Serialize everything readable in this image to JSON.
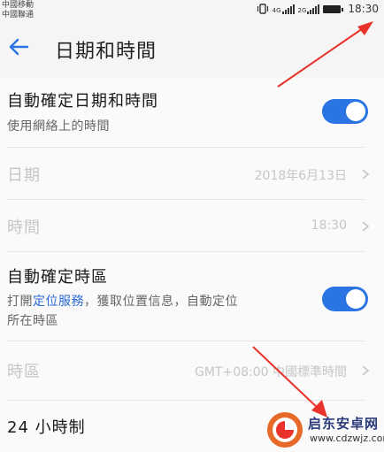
{
  "status_bar": {
    "carrier_1": "中國移動",
    "carrier_2": "中國聯通",
    "sim1_tag": "4G",
    "sim2_tag": "2G",
    "time": "18:30"
  },
  "header": {
    "back_icon": "arrow-left-icon",
    "title": "日期和時間"
  },
  "settings": {
    "auto_datetime": {
      "label": "自動確定日期和時間",
      "subtitle": "使用網絡上的時間",
      "enabled": true
    },
    "date": {
      "label": "日期",
      "value": "2018年6月13日"
    },
    "time": {
      "label": "時間",
      "value": "18:30"
    },
    "auto_timezone": {
      "label": "自動確定時區",
      "subtitle_pre": "打開",
      "subtitle_link": "定位服務",
      "subtitle_post_line1": "，獲取位置信息，自動定位",
      "subtitle_line2": "所在時區",
      "enabled": true
    },
    "timezone": {
      "label": "時區",
      "value": "GMT+08:00 中國標準時間"
    },
    "hour24": {
      "label": "24 小時制"
    }
  },
  "watermark": {
    "title": "启东安卓网",
    "url": "www.cdzwjz.com"
  },
  "colors": {
    "accent": "#2a75e3",
    "annotation": "#e8322a"
  }
}
